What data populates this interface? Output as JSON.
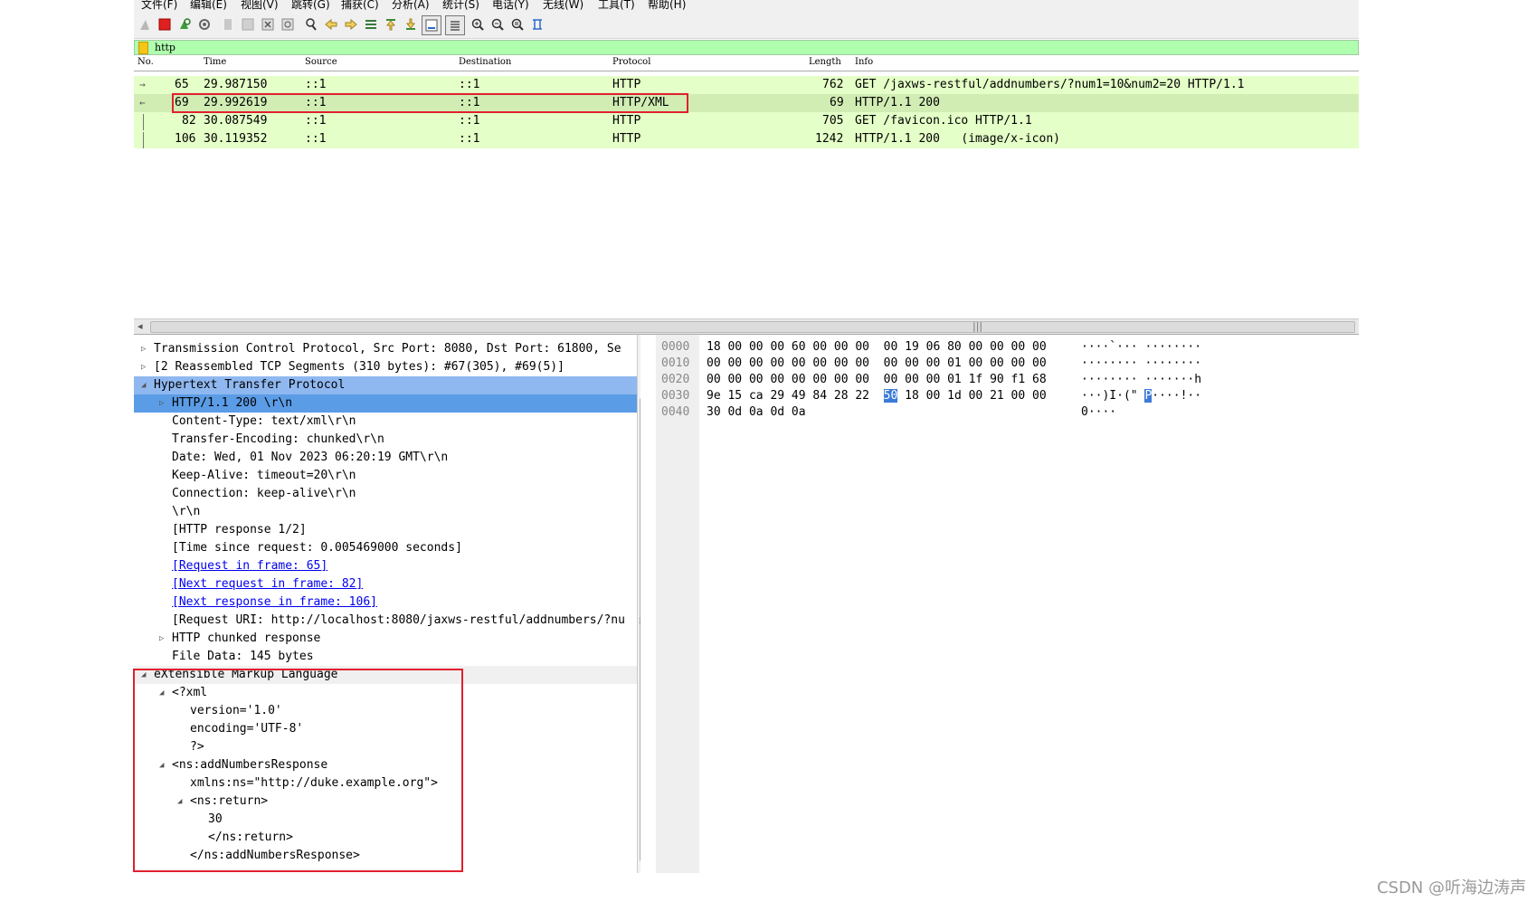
{
  "menu": [
    "文件(F)",
    "编辑(E)",
    "视图(V)",
    "跳转(G)",
    "捕获(C)",
    "分析(A)",
    "统计(S)",
    "电话(Y)",
    "无线(W)",
    "工具(T)",
    "帮助(H)"
  ],
  "toolbar": {
    "icons": [
      "shark-fin-start-icon",
      "stop-capture-icon",
      "restart-capture-icon",
      "capture-options-icon",
      "open-file-icon",
      "save-file-icon",
      "close-file-icon",
      "reload-file-icon",
      "find-packet-icon",
      "go-back-icon",
      "go-forward-icon",
      "go-to-packet-icon",
      "go-first-icon",
      "go-last-icon",
      "auto-scroll-icon",
      "colorize-icon",
      "zoom-in-icon",
      "zoom-out-icon",
      "normal-size-icon",
      "resize-columns-icon"
    ]
  },
  "filter": {
    "value": "http"
  },
  "packet_list": {
    "columns": [
      "No.",
      "Time",
      "Source",
      "Destination",
      "Protocol",
      "Length",
      "Info"
    ],
    "rows": [
      {
        "no": "65",
        "time": "29.987150",
        "src": "::1",
        "dst": "::1",
        "proto": "HTTP",
        "len": "762",
        "info": "GET /jaxws-restful/addnumbers/?num1=10&num2=20 HTTP/1.1"
      },
      {
        "no": "69",
        "time": "29.992619",
        "src": "::1",
        "dst": "::1",
        "proto": "HTTP/XML",
        "len": "69",
        "info": "HTTP/1.1 200"
      },
      {
        "no": "82",
        "time": "30.087549",
        "src": "::1",
        "dst": "::1",
        "proto": "HTTP",
        "len": "705",
        "info": "GET /favicon.ico HTTP/1.1"
      },
      {
        "no": "106",
        "time": "30.119352",
        "src": "::1",
        "dst": "::1",
        "proto": "HTTP",
        "len": "1242",
        "info": "HTTP/1.1 200   (image/x-icon)"
      }
    ]
  },
  "details": [
    "Transmission Control Protocol, Src Port: 8080, Dst Port: 61800, Se",
    "[2 Reassembled TCP Segments (310 bytes): #67(305), #69(5)]",
    "Hypertext Transfer Protocol",
    "HTTP/1.1 200 \\r\\n",
    "Content-Type: text/xml\\r\\n",
    "Transfer-Encoding: chunked\\r\\n",
    "Date: Wed, 01 Nov 2023 06:20:19 GMT\\r\\n",
    "Keep-Alive: timeout=20\\r\\n",
    "Connection: keep-alive\\r\\n",
    "\\r\\n",
    "[HTTP response 1/2]",
    "[Time since request: 0.005469000 seconds]",
    "[Request in frame: 65]",
    "[Next request in frame: 82]",
    "[Next response in frame: 106]",
    "[Request URI: http://localhost:8080/jaxws-restful/addnumbers/?nu",
    "HTTP chunked response",
    "File Data: 145 bytes",
    "eXtensible Markup Language",
    "<?xml",
    "version='1.0'",
    "encoding='UTF-8'",
    "?>",
    "<ns:addNumbersResponse",
    "xmlns:ns=\"http://duke.example.org\">",
    "<ns:return>",
    "30",
    "</ns:return>",
    "</ns:addNumbersResponse>"
  ],
  "hex": {
    "offsets": [
      "0000",
      "0010",
      "0020",
      "0030",
      "0040"
    ],
    "row0": "18 00 00 00 60 00 00 00  00 19 06 80 00 00 00 00",
    "row1": "00 00 00 00 00 00 00 00  00 00 00 01 00 00 00 00",
    "row2": "00 00 00 00 00 00 00 00  00 00 00 01 1f 90 f1 68",
    "row3_a": "9e 15 ca 29 49 84 28 22  ",
    "row3_sel": "50",
    "row3_b": " 18 00 1d 00 21 00 00",
    "row4": "30 0d 0a 0d 0a",
    "ascii0": "····`··· ········",
    "ascii1": "········ ········",
    "ascii2": "········ ·······h",
    "ascii3_a": "···)I·(\" ",
    "ascii3_sel": "P",
    "ascii3_b": "····!··",
    "ascii4": "0····"
  },
  "watermark": "CSDN @听海边涛声"
}
